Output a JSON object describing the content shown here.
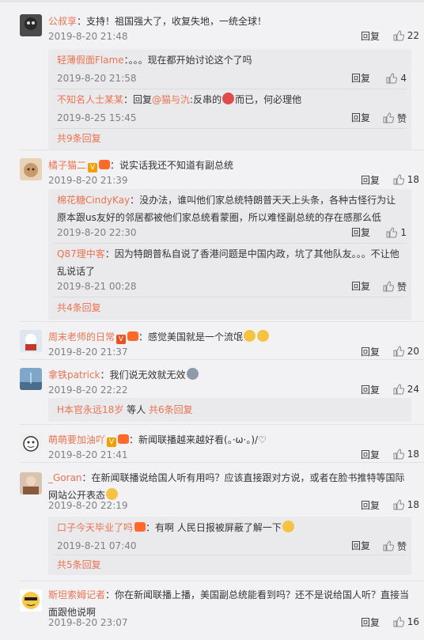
{
  "actions": {
    "reply": "回复",
    "like_icon": "thumbs-up-icon"
  },
  "comments": [
    {
      "username": "公叔享",
      "text": "：支持！祖国强大了，收复失地，一统全球！",
      "time": "2019-8-20 21:48",
      "likes": "22",
      "replies": [
        {
          "username": "轻薄假面Flame",
          "text": "：。。。现在都开始讨论这个了吗",
          "time": "2019-8-20 21:58",
          "likes": "4"
        },
        {
          "username": "不知名人士某某",
          "text_pre": "：回复",
          "mention": "@猫与氿",
          "text": ":反串的",
          "text_post": "而已，何必理他",
          "time": "2019-8-25 15:45",
          "likes": "赞"
        }
      ],
      "more": "共9条回复"
    },
    {
      "username": "橘子猫二",
      "text": "：说实话我还不知道有副总统",
      "time": "2019-8-20 21:39",
      "likes": "18",
      "replies": [
        {
          "username": "棉花糖CindyKay",
          "text": "：没办法，谁叫他们家总统特朗普天天上头条，各种古怪行为让原本跟us友好的邻居都被他们家总统看蒙圈，所以难怪副总统的存在感那么低",
          "time": "2019-8-20 22:30",
          "likes": "1"
        },
        {
          "username": "Q87理中客",
          "text": "：因为特朗普私自说了香港问题是中国内政，坑了其他队友。。。不让他乱说话了",
          "time": "2019-8-21 00:28",
          "likes": "赞"
        }
      ],
      "more": "共4条回复"
    },
    {
      "username": "周末老师的日常",
      "text": "：感觉美国就是一个流氓",
      "time": "2019-8-20 21:37",
      "likes": "20"
    },
    {
      "username": "拿铁patrick",
      "text": "：我们说无效就无效",
      "time": "2019-8-20 22:22",
      "likes": "24",
      "more_prefix": "H本官永远18岁",
      "more_mid": " 等人 ",
      "more": "共6条回复"
    },
    {
      "username": "萌萌要加油吖",
      "text": "：新闻联播越来越好看(。·ω·。)/♡",
      "time": "2019-8-20 21:41",
      "likes": "18"
    },
    {
      "username": "_Goran",
      "text": "：在新闻联播说给国人听有用吗？应该直接跟对方说，或者在脸书推特等国际网站公开表态",
      "time": "2019-8-20 22:19",
      "likes": "18",
      "replies": [
        {
          "username": "口子今天毕业了吗",
          "text": "：有啊 人民日报被屏蔽了解一下",
          "time": "2019-8-21 07:40",
          "likes": "赞"
        }
      ],
      "more": "共5条回复"
    },
    {
      "username": "斯坦索姆记者",
      "text": "：你在新闻联播上播，美国副总统能看到吗？还不是说给国人听？直接当面跟他说啊",
      "time": "2019-8-20 23:07",
      "likes": "16"
    }
  ]
}
